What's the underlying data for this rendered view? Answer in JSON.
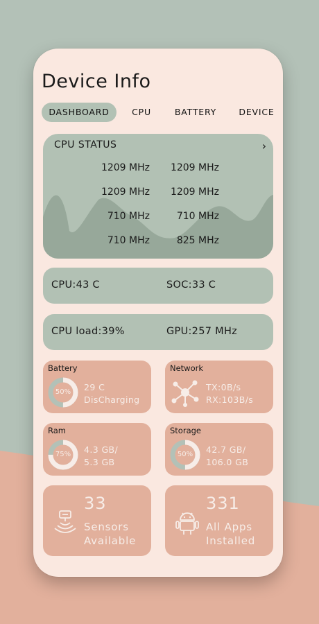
{
  "colors": {
    "sage": "#b3c1b7",
    "peach": "#e2b09c",
    "card": "#fae8e0",
    "tile_text": "#f7ede8"
  },
  "app": {
    "title": "Device Info"
  },
  "tabs": [
    "DASHBOARD",
    "CPU",
    "BATTERY",
    "DEVICE"
  ],
  "active_tab": "DASHBOARD",
  "cpu_status": {
    "title": "CPU STATUS",
    "frequencies": [
      [
        "1209 MHz",
        "1209 MHz"
      ],
      [
        "1209 MHz",
        "1209 MHz"
      ],
      [
        "710 MHz",
        "710 MHz"
      ],
      [
        "710 MHz",
        "825 MHz"
      ]
    ]
  },
  "temps": {
    "cpu": "CPU:43 C",
    "soc": "SOC:33 C"
  },
  "load": {
    "cpu_load": "CPU load:39%",
    "gpu": "GPU:257 MHz"
  },
  "battery": {
    "label": "Battery",
    "percent_text": "50%",
    "percent": 50,
    "line1": "29 C",
    "line2": "DisCharging"
  },
  "network": {
    "label": "Network",
    "icon": "network-nodes-icon",
    "line1": "TX:0B/s",
    "line2": "RX:103B/s"
  },
  "ram": {
    "label": "Ram",
    "percent_text": "75%",
    "percent": 75,
    "line1": "4.3 GB/",
    "line2": "5.3 GB"
  },
  "storage": {
    "label": "Storage",
    "percent_text": "50%",
    "percent": 50,
    "line1": "42.7 GB/",
    "line2": "106.0 GB"
  },
  "sensors": {
    "count": "33",
    "line1": "Sensors",
    "line2": "Available",
    "icon": "sensor-icon"
  },
  "apps": {
    "count": "331",
    "line1": "All Apps",
    "line2": "Installed",
    "icon": "android-icon"
  }
}
